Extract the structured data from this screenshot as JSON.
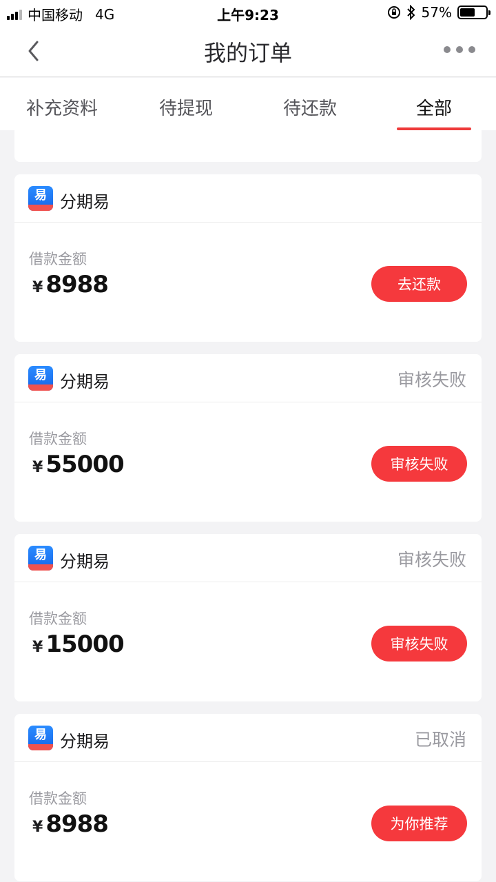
{
  "status_bar": {
    "carrier": "中国移动",
    "network": "4G",
    "time": "上午9:23",
    "battery": "57%",
    "battery_level": 0.57
  },
  "nav": {
    "title": "我的订单",
    "back_icon": "chevron-left-icon",
    "more_icon": "more-dots-icon"
  },
  "tabs": [
    {
      "label": "补充资料",
      "active": false
    },
    {
      "label": "待提现",
      "active": false
    },
    {
      "label": "待还款",
      "active": false
    },
    {
      "label": "全部",
      "active": true
    }
  ],
  "orders": [
    {
      "app_name": "分期易",
      "status": "",
      "amount_label": "借款金额",
      "currency": "¥",
      "amount": "8988",
      "action": "去还款"
    },
    {
      "app_name": "分期易",
      "status": "审核失败",
      "amount_label": "借款金额",
      "currency": "¥",
      "amount": "55000",
      "action": "审核失败"
    },
    {
      "app_name": "分期易",
      "status": "审核失败",
      "amount_label": "借款金额",
      "currency": "¥",
      "amount": "15000",
      "action": "审核失败"
    },
    {
      "app_name": "分期易",
      "status": "已取消",
      "amount_label": "借款金额",
      "currency": "¥",
      "amount": "8988",
      "action": "为你推荐"
    }
  ],
  "colors": {
    "accent": "#f5393d",
    "tab_indicator": "#ee3a3a",
    "muted_text": "#9a9aa0",
    "background": "#f3f3f5"
  }
}
